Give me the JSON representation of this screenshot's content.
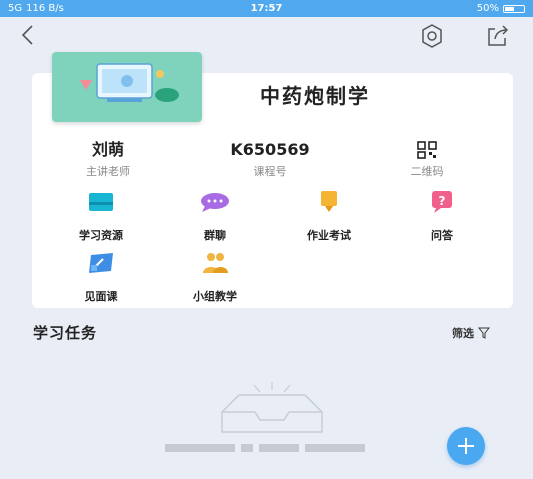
{
  "status_bar": {
    "signal": "5G",
    "speed": "116 B/s",
    "time": "17:57",
    "battery_text": "50%",
    "battery_level": 0.5
  },
  "nav": {
    "back_icon": "chevron-left-icon",
    "settings_icon": "gear-icon",
    "share_icon": "share-icon"
  },
  "course": {
    "title": "中药炮制学",
    "teacher_name": "刘萌",
    "teacher_label": "主讲老师",
    "course_code": "K650569",
    "course_code_label": "课程号",
    "qr_label": "二维码"
  },
  "features": [
    {
      "label": "学习资源",
      "icon": "folder-icon",
      "color": "#19b6d4"
    },
    {
      "label": "群聊",
      "icon": "chat-icon",
      "color": "#a86be3"
    },
    {
      "label": "作业考试",
      "icon": "exam-icon",
      "color": "#f5b431"
    },
    {
      "label": "问答",
      "icon": "question-icon",
      "color": "#f0608a"
    },
    {
      "label": "见面课",
      "icon": "meeting-icon",
      "color": "#3f8ee6"
    },
    {
      "label": "小组教学",
      "icon": "group-icon",
      "color": "#f0b440"
    }
  ],
  "tasks": {
    "title": "学习任务",
    "filter_label": "筛选",
    "filter_icon": "filter-icon",
    "empty_icon": "empty-inbox-icon"
  },
  "fab": {
    "icon": "plus-icon",
    "color": "#4aa8f0"
  }
}
